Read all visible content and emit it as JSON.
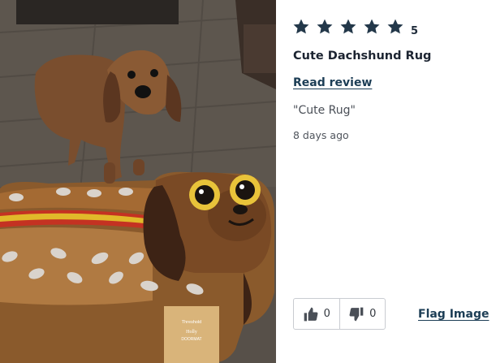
{
  "review": {
    "rating_value": "5",
    "rating_stars": 5,
    "title": "Cute Dachshund Rug",
    "read_review_label": "Read review",
    "quote": "\"Cute Rug\"",
    "time_ago": "8 days ago",
    "thumbs_up_count": "0",
    "thumbs_down_count": "0",
    "flag_label": "Flag Image"
  },
  "photo": {
    "card_brand": "Threshold",
    "card_line2": "Holly",
    "card_line3": "DOORMAT"
  },
  "icons": {
    "star": "star-icon",
    "thumbs_up": "thumbs-up-icon",
    "thumbs_down": "thumbs-down-icon"
  },
  "colors": {
    "star": "#23384a",
    "link": "#1c3d55",
    "text": "#1c2431",
    "border": "#c9ccd1"
  }
}
